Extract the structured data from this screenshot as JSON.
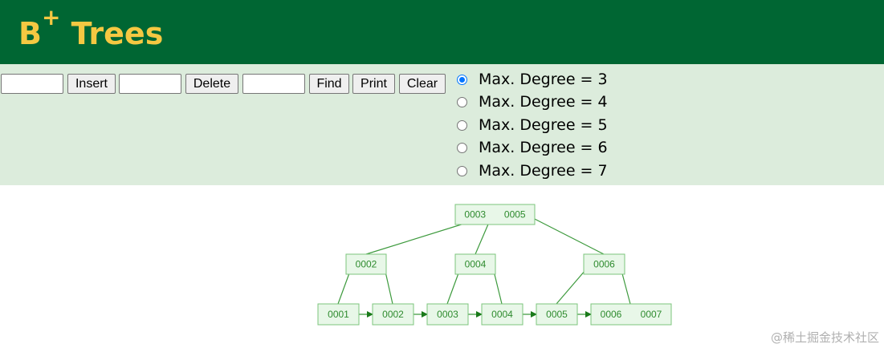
{
  "header": {
    "title": "B",
    "title_sup": "+",
    "title_rest": " Trees",
    "bg_color": "#006633",
    "title_color": "#f5c842"
  },
  "controls": {
    "bg_color": "#dcecdc",
    "insert_input": {
      "value": ""
    },
    "insert_label": "Insert",
    "delete_input": {
      "value": ""
    },
    "delete_label": "Delete",
    "find_input": {
      "value": ""
    },
    "find_label": "Find",
    "print_label": "Print",
    "clear_label": "Clear",
    "degree_options": [
      {
        "label": "Max. Degree = 3",
        "checked": true
      },
      {
        "label": "Max. Degree = 4",
        "checked": false
      },
      {
        "label": "Max. Degree = 5",
        "checked": false
      },
      {
        "label": "Max. Degree = 6",
        "checked": false
      },
      {
        "label": "Max. Degree = 7",
        "checked": false
      }
    ]
  },
  "tree": {
    "node_fill": "#e8f7e8",
    "node_stroke": "#7cc47c",
    "edge_color": "#3d9a3d",
    "root": {
      "keys": [
        "0003",
        "0005"
      ]
    },
    "internal": [
      {
        "keys": [
          "0002"
        ]
      },
      {
        "keys": [
          "0004"
        ]
      },
      {
        "keys": [
          "0006"
        ]
      }
    ],
    "leaves": [
      {
        "keys": [
          "0001"
        ]
      },
      {
        "keys": [
          "0002"
        ]
      },
      {
        "keys": [
          "0003"
        ]
      },
      {
        "keys": [
          "0004"
        ]
      },
      {
        "keys": [
          "0005"
        ]
      },
      {
        "keys": [
          "0006",
          "0007"
        ]
      }
    ]
  },
  "watermark": "@稀土掘金技术社区"
}
